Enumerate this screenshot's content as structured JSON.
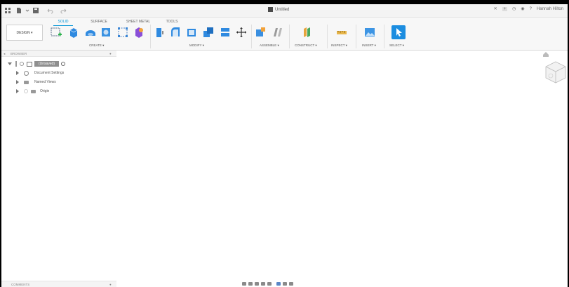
{
  "window": {
    "title": "Untitled",
    "user": "Hannah Hilton"
  },
  "ribbon": {
    "design_label": "DESIGN ▾",
    "tabs": [
      "SOLID",
      "SURFACE",
      "SHEET METAL",
      "TOOLS"
    ],
    "active_tab": "SOLID",
    "groups": [
      {
        "label": "CREATE ▾"
      },
      {
        "label": "MODIFY ▾"
      },
      {
        "label": "ASSEMBLE ▾"
      },
      {
        "label": "CONSTRUCT ▾"
      },
      {
        "label": "INSPECT ▾"
      },
      {
        "label": "INSERT ▾"
      },
      {
        "label": "SELECT ▾"
      }
    ]
  },
  "browser": {
    "header": "BROWSER",
    "root": "(Unsaved)",
    "items": [
      {
        "label": "Document Settings",
        "icon": "gear-icon"
      },
      {
        "label": "Named Views",
        "icon": "folder-icon"
      },
      {
        "label": "Origin",
        "icon": "folder-icon"
      }
    ]
  },
  "comments": {
    "header": "COMMENTS"
  },
  "colors": {
    "accent": "#0696d7",
    "tool_blue": "#2f8ae0",
    "select_blue": "#1c8de0"
  }
}
